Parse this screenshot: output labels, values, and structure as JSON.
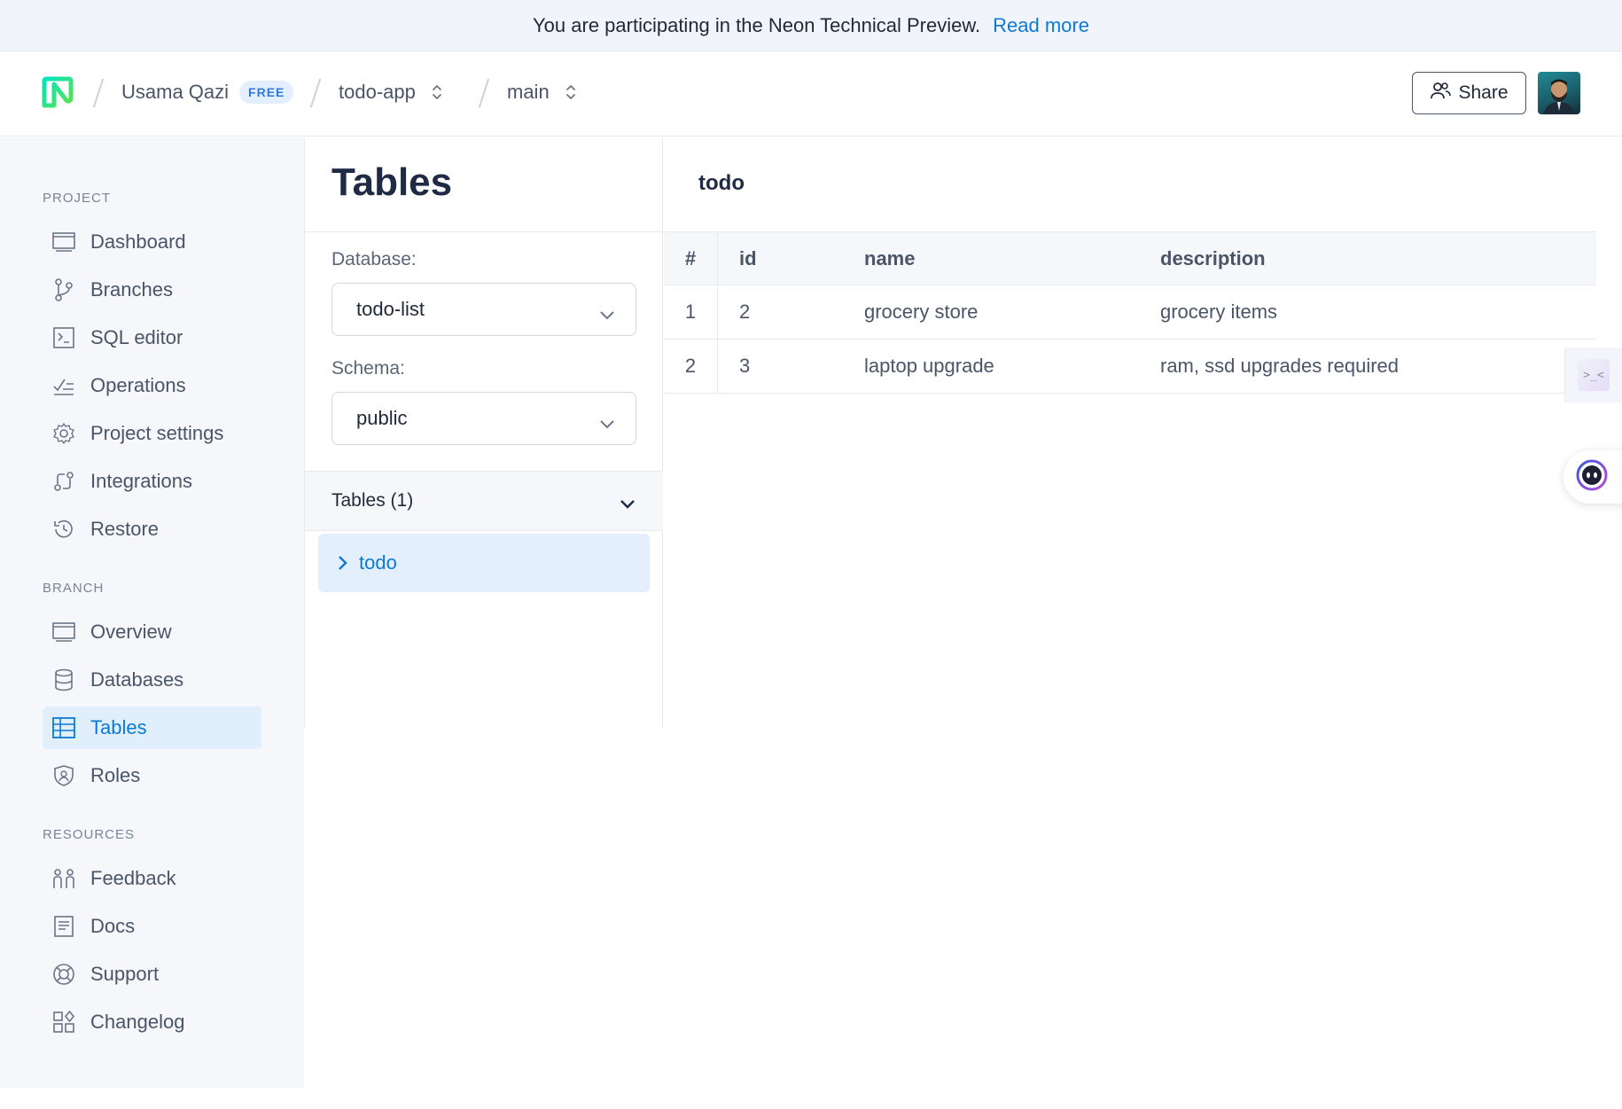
{
  "banner": {
    "text": "You are participating in the Neon Technical Preview.",
    "link": "Read more"
  },
  "header": {
    "user": "Usama Qazi",
    "plan_badge": "FREE",
    "project": "todo-app",
    "branch": "main",
    "share_label": "Share"
  },
  "sidebar": {
    "project_label": "PROJECT",
    "project_items": [
      {
        "label": "Dashboard",
        "icon": "dashboard-icon"
      },
      {
        "label": "Branches",
        "icon": "branches-icon"
      },
      {
        "label": "SQL editor",
        "icon": "sql-editor-icon"
      },
      {
        "label": "Operations",
        "icon": "operations-icon"
      },
      {
        "label": "Project settings",
        "icon": "gear-icon"
      },
      {
        "label": "Integrations",
        "icon": "integrations-icon"
      },
      {
        "label": "Restore",
        "icon": "restore-icon"
      }
    ],
    "branch_label": "BRANCH",
    "branch_items": [
      {
        "label": "Overview",
        "icon": "overview-icon"
      },
      {
        "label": "Databases",
        "icon": "database-icon"
      },
      {
        "label": "Tables",
        "icon": "table-icon",
        "active": true
      },
      {
        "label": "Roles",
        "icon": "roles-icon"
      }
    ],
    "resources_label": "RESOURCES",
    "resources_items": [
      {
        "label": "Feedback",
        "icon": "feedback-icon"
      },
      {
        "label": "Docs",
        "icon": "docs-icon"
      },
      {
        "label": "Support",
        "icon": "support-icon"
      },
      {
        "label": "Changelog",
        "icon": "changelog-icon"
      }
    ]
  },
  "tables_panel": {
    "title": "Tables",
    "database_label": "Database:",
    "database_value": "todo-list",
    "schema_label": "Schema:",
    "schema_value": "public",
    "tables_header": "Tables (1)",
    "tables": [
      "todo"
    ]
  },
  "table_view": {
    "title": "todo",
    "columns": [
      "#",
      "id",
      "name",
      "description"
    ],
    "rows": [
      [
        "1",
        "2",
        "grocery store",
        "grocery items"
      ],
      [
        "2",
        "3",
        "laptop upgrade",
        "ram, ssd upgrades required"
      ]
    ]
  },
  "colors": {
    "accent": "#0b7ad6",
    "active_bg": "#e1eefc",
    "sidebar_bg": "#f5f7fa"
  }
}
